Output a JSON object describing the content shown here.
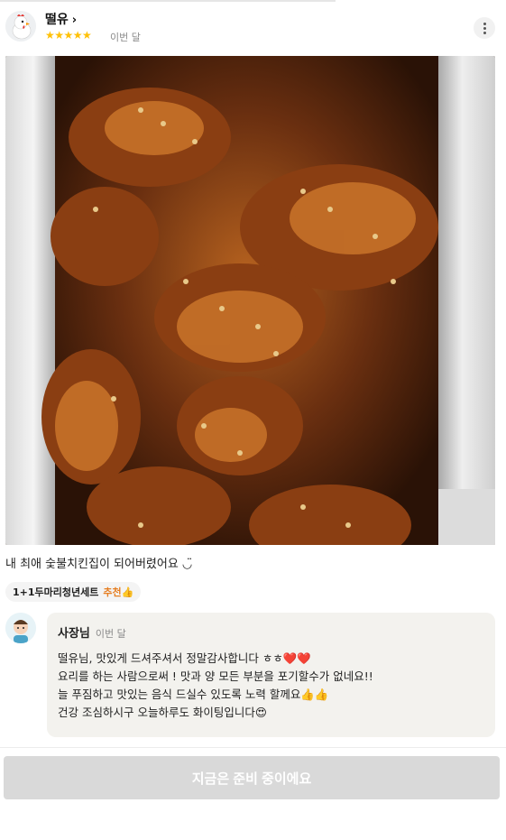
{
  "review": {
    "username": "떨유",
    "chevron": "›",
    "stars": "★★★★★",
    "rating": 5,
    "date": "이번 달",
    "more_icon": "more-vertical-icon",
    "text": "내 최애 숯불치킨집이 되어버렸어요 ◡̈",
    "menu_tag": {
      "name": "1+1두마리청년세트",
      "recommend": "추천👍"
    }
  },
  "owner_reply": {
    "name": "사장님",
    "date": "이번 달",
    "lines": [
      "떨유님, 맛있게 드셔주셔서 정말감사합니다 ㅎㅎ❤️❤️",
      "요리를 하는 사람으로써 ! 맛과 양 모든 부분을 포기할수가 없네요!!",
      "늘 푸짐하고 맛있는 음식 드실수 있도록 노력 할께요👍👍",
      "건강 조심하시구 오늘하루도 화이팅입니다😍"
    ]
  },
  "cta": {
    "label": "지금은 준비 중이에요"
  },
  "colors": {
    "star": "#ffc107",
    "reply_bg": "#f3f2ee",
    "cta_bg": "#d9d9d9",
    "recommend": "#e67e22"
  }
}
